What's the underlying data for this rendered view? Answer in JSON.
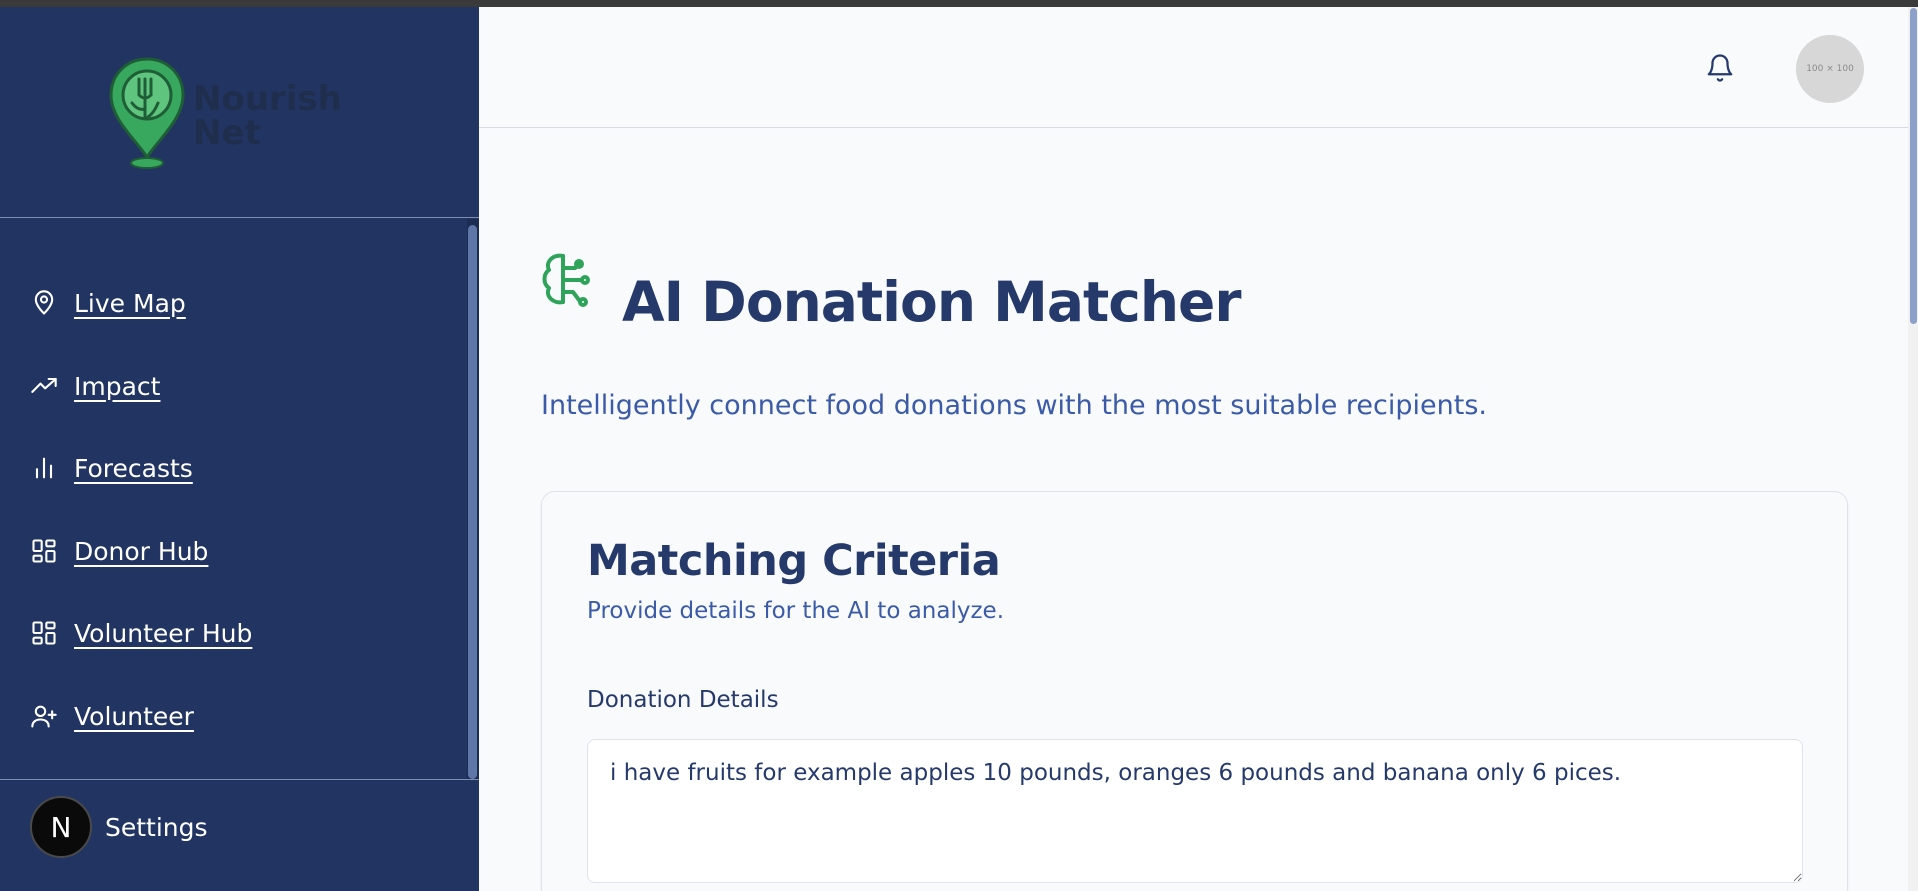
{
  "app": {
    "logo_line1": "Nourish",
    "logo_line2": "Net"
  },
  "sidebar": {
    "items": [
      {
        "label": "Live Map",
        "icon": "map-pin-icon"
      },
      {
        "label": "Impact",
        "icon": "trending-up-icon"
      },
      {
        "label": "Forecasts",
        "icon": "bar-chart-icon"
      },
      {
        "label": "Donor Hub",
        "icon": "dashboard-grid-icon"
      },
      {
        "label": "Volunteer Hub",
        "icon": "dashboard-grid-icon"
      },
      {
        "label": "Volunteer",
        "icon": "user-plus-icon"
      }
    ],
    "footer": {
      "badge": "N",
      "settings_label": "Settings"
    }
  },
  "header": {
    "avatar_text": "100 × 100"
  },
  "main": {
    "title": "AI Donation Matcher",
    "subtitle": "Intelligently connect food donations with the most suitable recipients.",
    "card": {
      "title": "Matching Criteria",
      "subtitle": "Provide details for the AI to analyze.",
      "donation_label": "Donation Details",
      "donation_value": "i have fruits for example apples 10 pounds, oranges 6 pounds and banana only 6 pices."
    }
  },
  "colors": {
    "sidebar_bg": "#213462",
    "title": "#25396b",
    "accent": "#3b5ba8",
    "brand_green": "#2fa35a"
  }
}
